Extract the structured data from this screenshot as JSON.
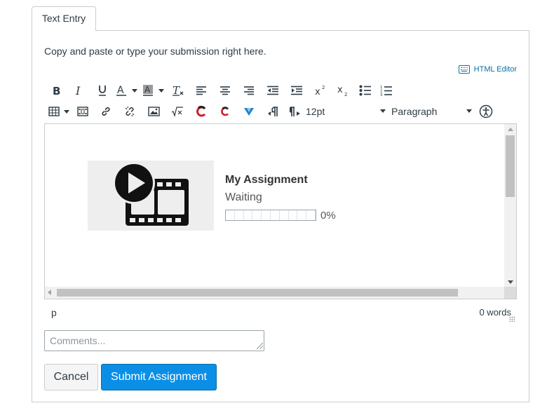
{
  "tab": {
    "label": "Text Entry"
  },
  "instructions": "Copy and paste or type your submission right here.",
  "html_editor_link": "HTML Editor",
  "toolbar": {
    "row1": [
      "bold-icon",
      "italic-icon",
      "underline-icon",
      "text-color-icon",
      "background-color-icon",
      "clear-formatting-icon",
      "align-left-icon",
      "align-center-icon",
      "align-right-icon",
      "outdent-icon",
      "indent-icon",
      "superscript-icon",
      "subscript-icon",
      "bullet-list-icon",
      "numbered-list-icon"
    ],
    "row2": [
      "table-icon",
      "media-icon",
      "link-icon",
      "unlink-icon",
      "image-icon",
      "equation-icon",
      "plugin-c-icon",
      "plugin-c2-icon",
      "plugin-v-icon",
      "ltr-icon",
      "rtl-icon",
      "accessibility-icon"
    ],
    "font_size": "12pt",
    "block_format": "Paragraph"
  },
  "media": {
    "title": "My Assignment",
    "status": "Waiting",
    "progress_fraction": 0.0,
    "progress_label": "0%"
  },
  "statusbar": {
    "element_path": "p",
    "word_count": "0 words"
  },
  "comments": {
    "placeholder": "Comments..."
  },
  "buttons": {
    "cancel": "Cancel",
    "submit": "Submit Assignment"
  },
  "colors": {
    "accent": "#0b8fe6",
    "link": "#0770a3",
    "text": "#2d3b45",
    "border": "#c7cdd1"
  }
}
